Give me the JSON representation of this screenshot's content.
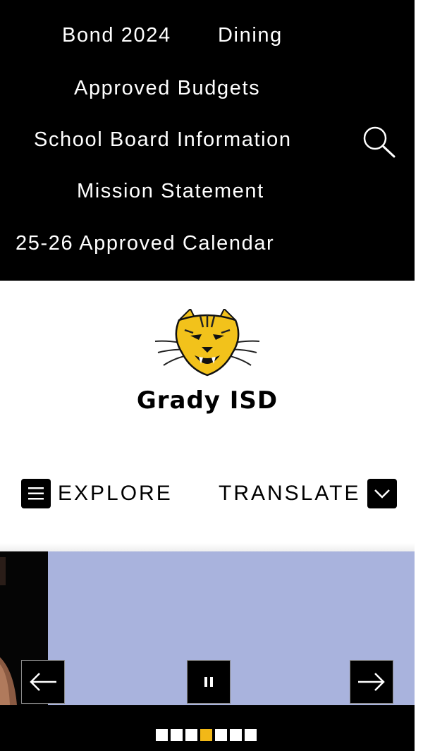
{
  "nav": {
    "links": [
      "Bond 2024",
      "Dining",
      "Approved Budgets",
      "School Board Information",
      "Mission Statement",
      "25-26 Approved Calendar"
    ],
    "search_icon": "search-icon"
  },
  "header": {
    "logo_icon": "wildcat-logo",
    "title": "Grady ISD",
    "explore_label": "EXPLORE",
    "explore_icon": "hamburger-menu-icon",
    "translate_label": "TRANSLATE",
    "translate_icon": "chevron-down-icon"
  },
  "carousel": {
    "prev_icon": "arrow-left-icon",
    "pause_icon": "pause-icon",
    "next_icon": "arrow-right-icon",
    "slide_count": 7,
    "active_index": 3,
    "background_color": "#a9b3dd"
  },
  "colors": {
    "nav_bg": "#000000",
    "accent": "#f2b817",
    "text": "#000000"
  }
}
